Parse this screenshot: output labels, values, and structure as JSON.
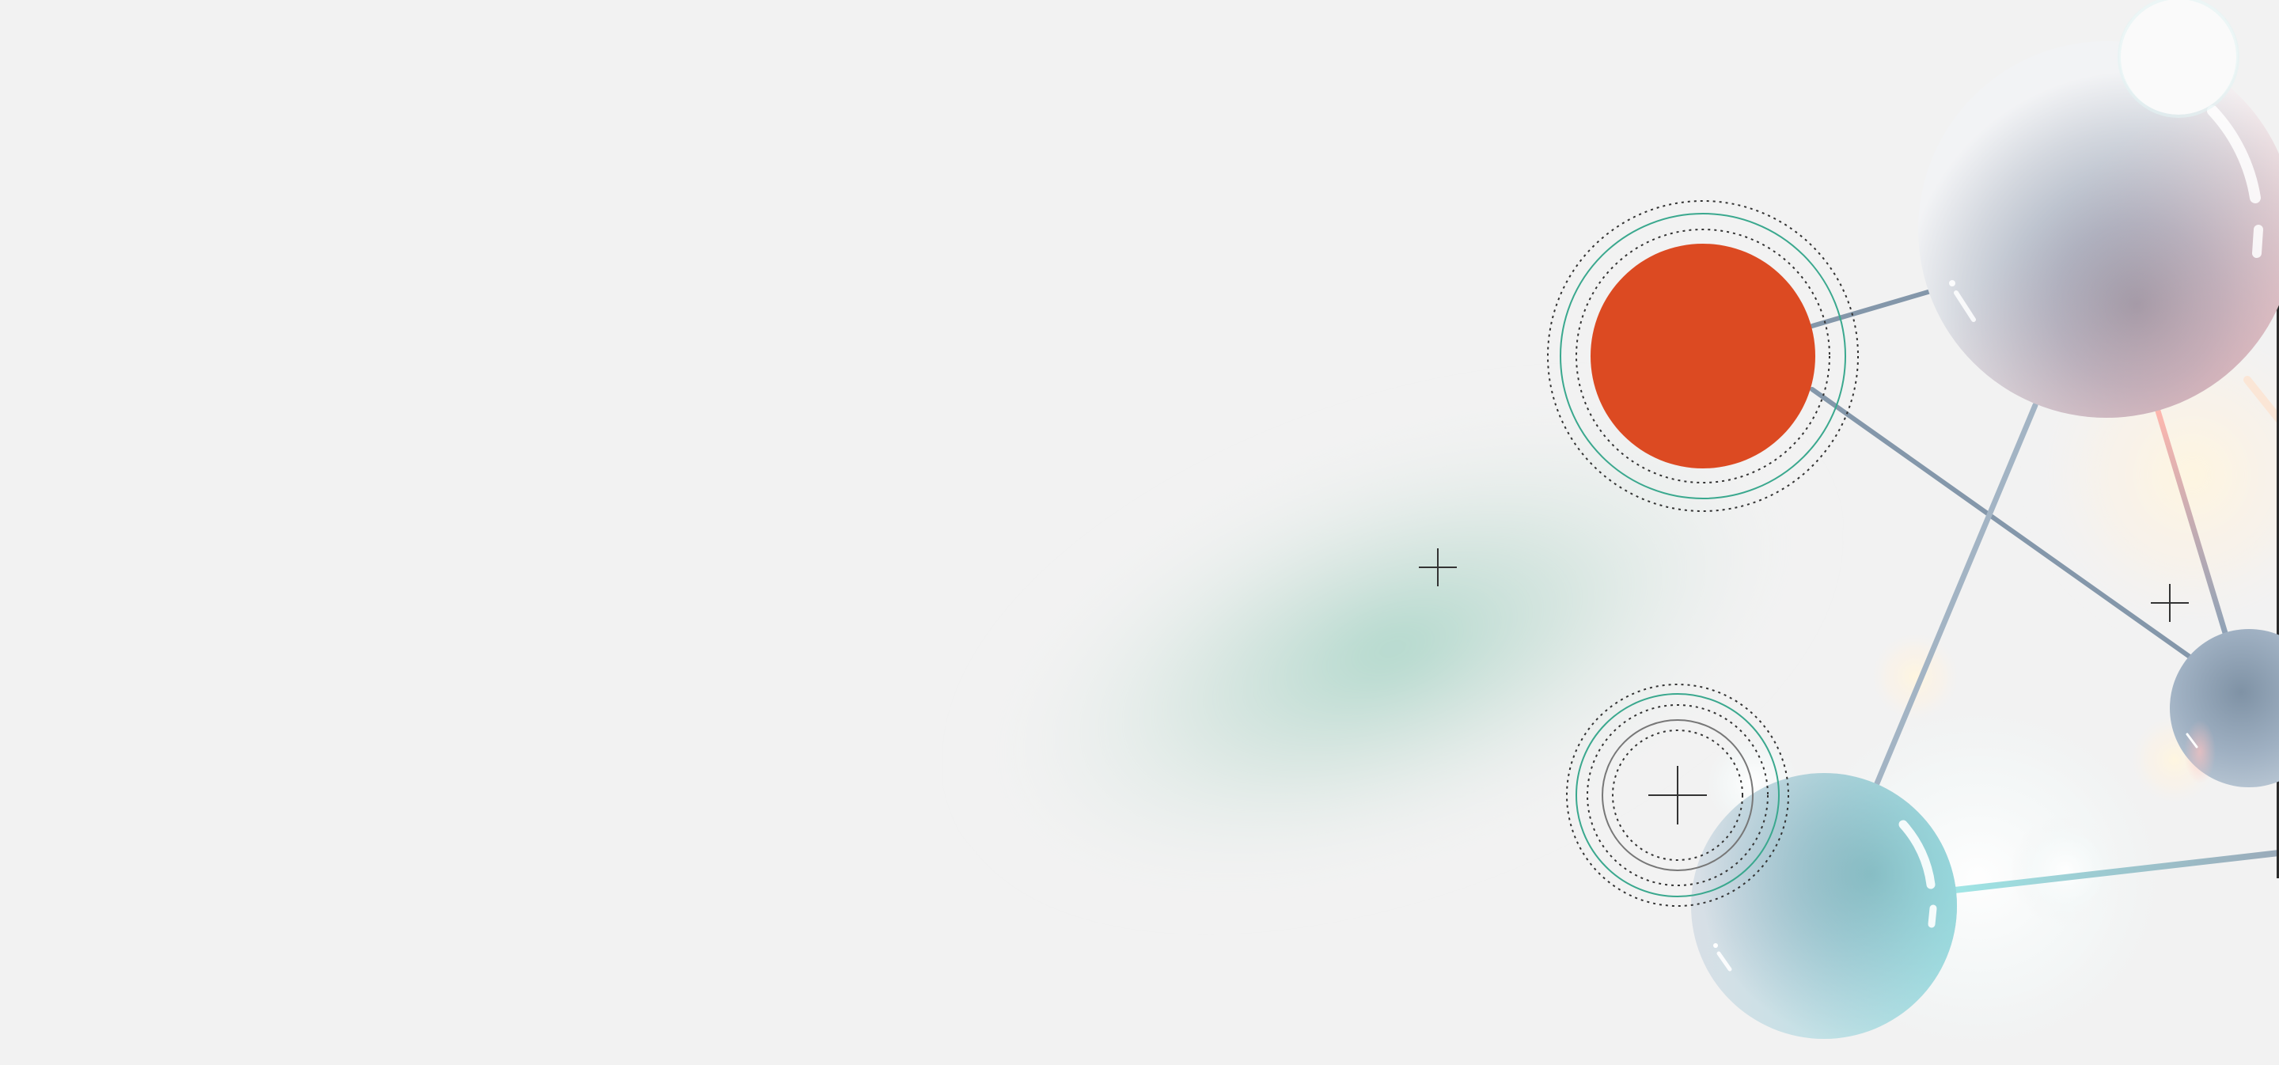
{
  "scene": {
    "background_color": "#f2f2f2",
    "accent_color": "#dc4a22",
    "ring_green": "#3aa88e",
    "ring_dark": "#333333",
    "connector_color": "#8497aa",
    "glow_color": "#a7d4c6"
  },
  "icons": [
    "plus-marker-icon",
    "crosshair-icon",
    "molecule-node-icon"
  ]
}
